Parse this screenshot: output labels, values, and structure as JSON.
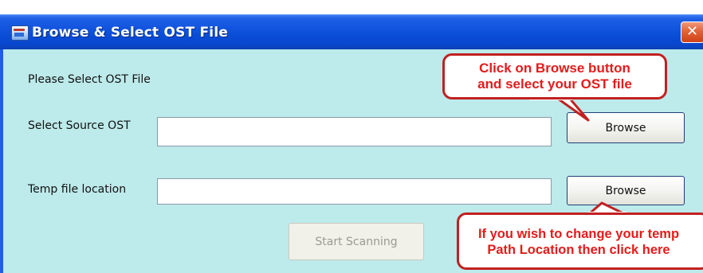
{
  "window": {
    "title": "Browse & Select OST File",
    "close_glyph": "✕"
  },
  "form": {
    "instruction": "Please Select OST File",
    "source_label": "Select Source OST",
    "source_value": "",
    "temp_label": "Temp file location",
    "temp_value": "",
    "browse_label_1": "Browse",
    "browse_label_2": "Browse",
    "start_label": "Start Scanning"
  },
  "callouts": {
    "browse_hint_line1": "Click on Browse button",
    "browse_hint_line2": "and select your OST file",
    "temp_hint_line1": "If you wish to change your temp",
    "temp_hint_line2": "Path Location then click here"
  },
  "colors": {
    "titlebar": "#0a4ed8",
    "dialog_bg": "#bdeaea",
    "callout_text": "#e41b1b",
    "close_button": "#e2623a"
  },
  "icons": {
    "app": "app-document-icon",
    "close": "close-icon"
  }
}
